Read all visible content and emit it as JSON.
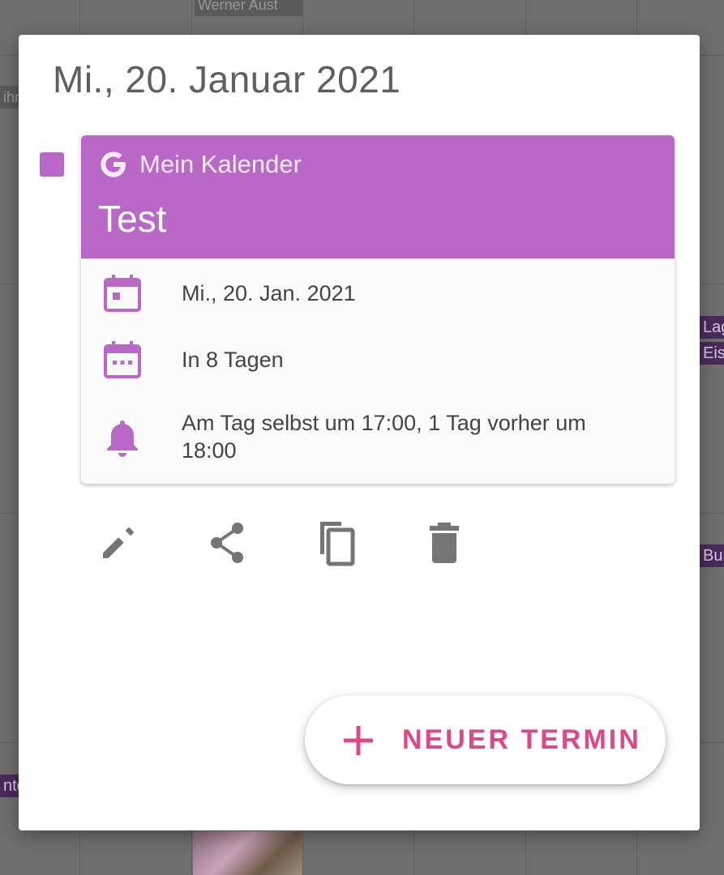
{
  "background": {
    "chips": [
      "Werner Aust",
      "ihn",
      "Lagi",
      "Eis",
      "Bun",
      "nto"
    ]
  },
  "dialog": {
    "date_title": "Mi., 20. Januar 2021",
    "accent_color": "#b968c7",
    "event": {
      "calendar_icon": "google-icon",
      "calendar_name": "Mein Kalender",
      "title": "Test",
      "details": [
        {
          "icon": "calendar-event-icon",
          "text": "Mi., 20. Jan. 2021"
        },
        {
          "icon": "calendar-dots-icon",
          "text": "In 8 Tagen"
        },
        {
          "icon": "bell-icon",
          "text": "Am Tag selbst um 17:00, 1 Tag vorher um 18:00"
        }
      ]
    },
    "actions": [
      {
        "icon": "edit-icon"
      },
      {
        "icon": "share-icon"
      },
      {
        "icon": "copy-icon"
      },
      {
        "icon": "delete-icon"
      }
    ],
    "fab": {
      "icon": "plus-icon",
      "label": "NEUER TERMIN",
      "color": "#e0478a"
    }
  }
}
